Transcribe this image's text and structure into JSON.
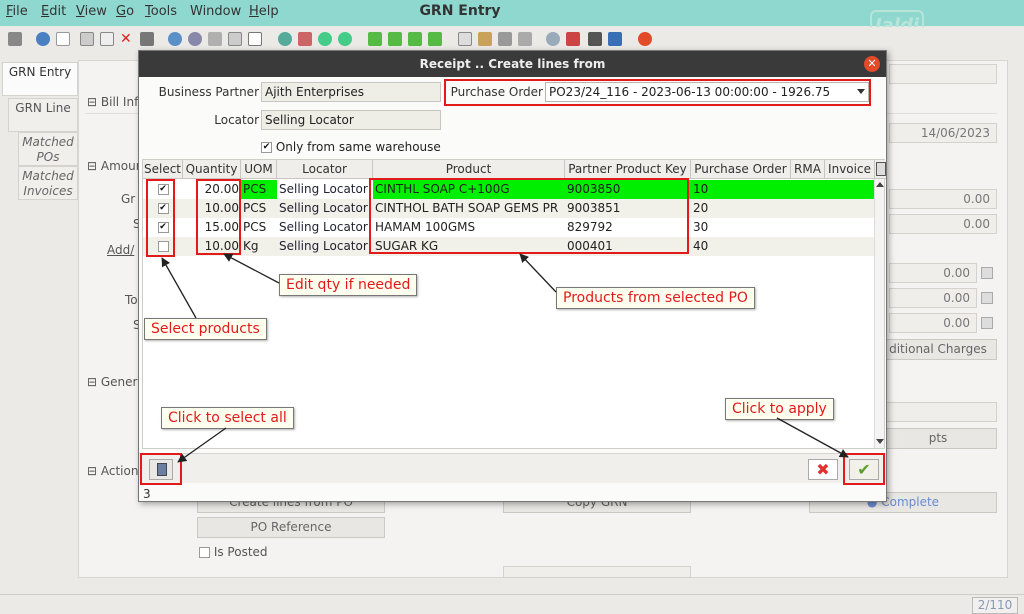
{
  "window": {
    "title": "GRN Entry",
    "logo_text": "Jaldi",
    "menu": [
      {
        "label": "File",
        "mnemonic": "F"
      },
      {
        "label": "Edit",
        "mnemonic": "E"
      },
      {
        "label": "View",
        "mnemonic": "V"
      },
      {
        "label": "Go",
        "mnemonic": "G"
      },
      {
        "label": "Tools",
        "mnemonic": "T"
      },
      {
        "label": "Window",
        "mnemonic": ""
      },
      {
        "label": "Help",
        "mnemonic": "H"
      }
    ]
  },
  "side_tabs": [
    {
      "label": "GRN Entry"
    },
    {
      "label": "GRN Line"
    },
    {
      "label": "Matched POs"
    },
    {
      "label": "Matched Invoices"
    }
  ],
  "background": {
    "sections": {
      "bill_info": "Bill Info",
      "amount": "Amour",
      "general": "Genera",
      "action": "Action"
    },
    "labels": {
      "gr": "Gr",
      "s1": "S",
      "add": "Add/",
      "to": "To",
      "s2": "S"
    },
    "date_value": "14/06/2023",
    "amounts": [
      "0.00",
      "0.00",
      "0.00",
      "0.00",
      "0.00"
    ],
    "additional_charges_button": "ditional Charges",
    "receipts_button": "pts",
    "create_lines_button": "Create lines from PO",
    "copy_grn_button": "Copy GRN",
    "complete_button": "Complete",
    "po_reference_button": "PO Reference",
    "is_posted_label": "Is Posted",
    "pager": "2/110"
  },
  "dialog": {
    "title": "Receipt .. Create lines from",
    "business_partner_label": "Business Partner",
    "business_partner_value": "Ajith Enterprises",
    "purchase_order_label": "Purchase Order",
    "purchase_order_value": "PO23/24_116 - 2023-06-13 00:00:00 - 1926.75",
    "locator_label": "Locator",
    "locator_value": "Selling Locator",
    "only_same_warehouse_label": "Only from same warehouse",
    "only_same_warehouse_checked": true,
    "columns": [
      "Select",
      "Quantity",
      "UOM",
      "Locator",
      "Product",
      "Partner Product Key",
      "Purchase Order",
      "RMA",
      "Invoice"
    ],
    "rows": [
      {
        "selected": true,
        "quantity": "20.00",
        "uom": "PCS",
        "locator": "Selling Locator",
        "product": "CINTHL SOAP C+100G",
        "partner_key": "9003850",
        "purchase_order": "10",
        "rma": "",
        "invoice": "",
        "highlight": true
      },
      {
        "selected": true,
        "quantity": "10.00",
        "uom": "PCS",
        "locator": "Selling Locator",
        "product": "CINTHOL BATH SOAP GEMS PR",
        "partner_key": "9003851",
        "purchase_order": "20",
        "rma": "",
        "invoice": "",
        "highlight": false
      },
      {
        "selected": true,
        "quantity": "15.00",
        "uom": "PCS",
        "locator": "Selling Locator",
        "product": "HAMAM 100GMS",
        "partner_key": "829792",
        "purchase_order": "30",
        "rma": "",
        "invoice": "",
        "highlight": false
      },
      {
        "selected": false,
        "quantity": "10.00",
        "uom": "Kg",
        "locator": "Selling Locator",
        "product": "SUGAR KG",
        "partner_key": "000401",
        "purchase_order": "40",
        "rma": "",
        "invoice": "",
        "highlight": false
      }
    ],
    "row_count": "3"
  },
  "annotations": {
    "edit_qty": "Edit qty if needed",
    "products_from_po": "Products from selected PO",
    "select_products": "Select products",
    "click_select_all": "Click to select all",
    "click_apply": "Click to apply"
  },
  "colors": {
    "menubar": "#8fd8cf",
    "highlight_row": "#00ee00",
    "annotation_red": "#e21a1a",
    "ok_green": "#5a9e2b"
  }
}
